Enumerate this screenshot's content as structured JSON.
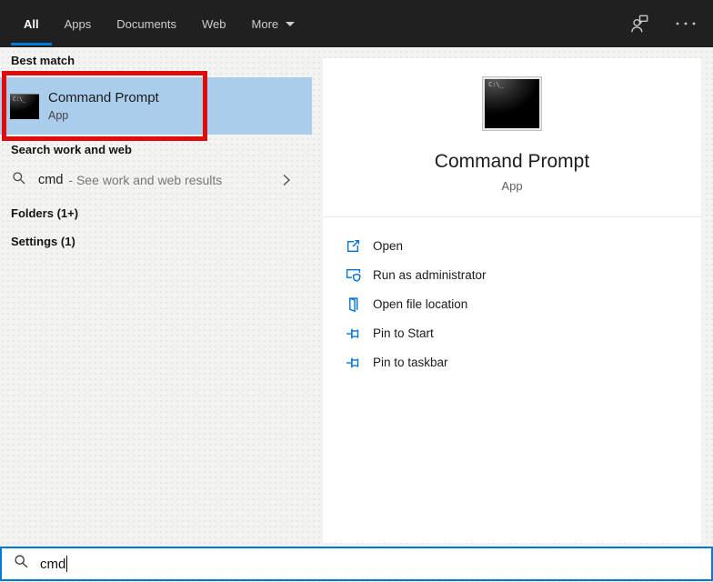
{
  "topbar": {
    "tabs": [
      {
        "label": "All",
        "active": true
      },
      {
        "label": "Apps",
        "active": false
      },
      {
        "label": "Documents",
        "active": false
      },
      {
        "label": "Web",
        "active": false
      },
      {
        "label": "More",
        "active": false,
        "has_dropdown": true
      }
    ],
    "icons": [
      {
        "name": "feedback-person-icon"
      },
      {
        "name": "more-options-ellipsis-icon"
      }
    ]
  },
  "left_pane": {
    "best_match_header": "Best match",
    "best_match": {
      "title": "Command Prompt",
      "type": "App",
      "icon": "cmd-terminal-icon"
    },
    "web_header": "Search work and web",
    "web_row": {
      "query": "cmd",
      "hint": "- See work and web results",
      "icon": "search-icon",
      "chevron": "chevron-right-icon"
    },
    "folders_header": "Folders (1+)",
    "settings_header": "Settings (1)"
  },
  "preview": {
    "title": "Command Prompt",
    "type": "App",
    "icon": "cmd-terminal-icon",
    "actions": [
      {
        "label": "Open",
        "icon": "open-icon"
      },
      {
        "label": "Run as administrator",
        "icon": "run-as-admin-shield-icon"
      },
      {
        "label": "Open file location",
        "icon": "open-file-location-icon"
      },
      {
        "label": "Pin to Start",
        "icon": "pin-icon"
      },
      {
        "label": "Pin to taskbar",
        "icon": "pin-icon"
      }
    ]
  },
  "search_box": {
    "value": "cmd",
    "icon": "search-icon"
  },
  "annotation": {
    "type": "red-highlight-box",
    "target": "Command Prompt best match row"
  },
  "colors": {
    "accent": "#0078d7",
    "selection_blue": "#a9cdeb",
    "topbar_bg": "#202021",
    "annotation_red": "#e00b0b",
    "page_bg": "#f3f3f2",
    "panel_bg": "#ffffff"
  }
}
